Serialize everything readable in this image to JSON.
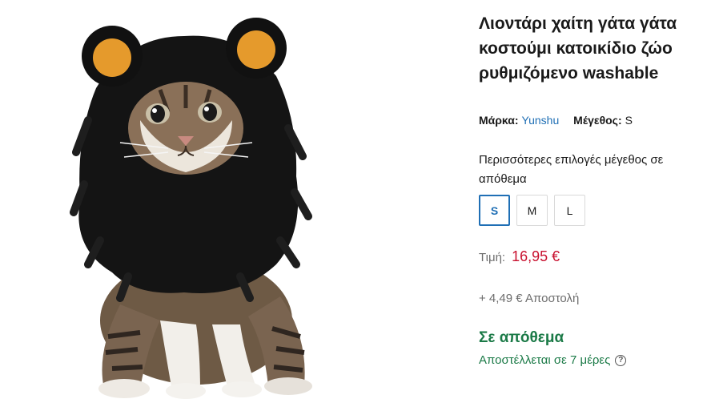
{
  "product": {
    "title": "Λιοντάρι χαίτη γάτα γάτα κοστούμι κατοικίδιο ζώο ρυθμιζόμενο washable",
    "brand_label": "Μάρκα:",
    "brand_value": "Yunshu",
    "size_label": "Μέγεθος:",
    "size_value": "S",
    "image_subject": "cat-in-lion-mane-costume"
  },
  "sizes": {
    "heading": "Περισσότερες επιλογές μέγεθος σε απόθεμα",
    "options": [
      "S",
      "M",
      "L"
    ],
    "selected": "S"
  },
  "pricing": {
    "price_label": "Τιμή:",
    "price_value": "16,95 €",
    "shipping": "+ 4,49 € Αποστολή"
  },
  "availability": {
    "status": "Σε απόθεμα",
    "delivery": "Αποστέλλεται σε 7 μέρες"
  },
  "colors": {
    "brand_link": "#1f6fb5",
    "price": "#c8102e",
    "stock": "#1b7a47",
    "selected_border": "#1f6fb5"
  },
  "icons": {
    "help": "question-circle-icon"
  }
}
